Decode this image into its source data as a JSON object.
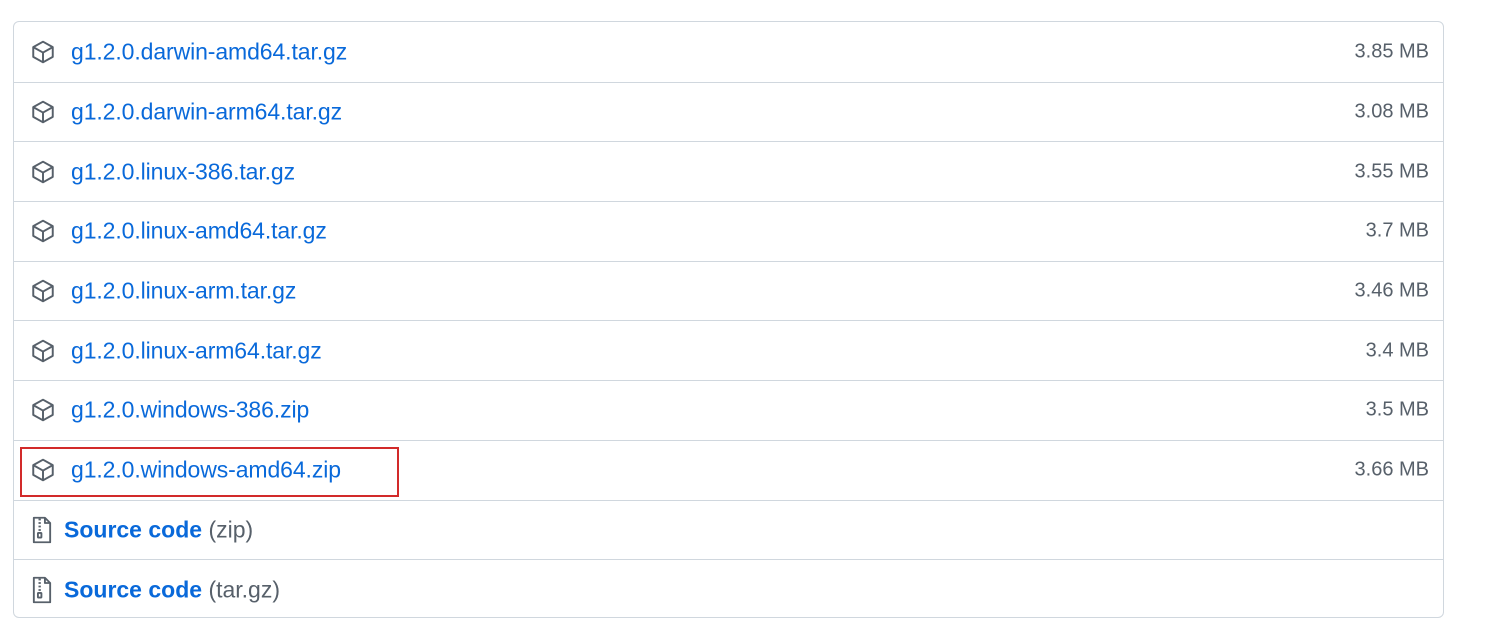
{
  "assets": [
    {
      "name": "g1.2.0.darwin-amd64.tar.gz",
      "size": "3.85 MB",
      "icon": "package-icon"
    },
    {
      "name": "g1.2.0.darwin-arm64.tar.gz",
      "size": "3.08 MB",
      "icon": "package-icon"
    },
    {
      "name": "g1.2.0.linux-386.tar.gz",
      "size": "3.55 MB",
      "icon": "package-icon"
    },
    {
      "name": "g1.2.0.linux-amd64.tar.gz",
      "size": "3.7 MB",
      "icon": "package-icon"
    },
    {
      "name": "g1.2.0.linux-arm.tar.gz",
      "size": "3.46 MB",
      "icon": "package-icon"
    },
    {
      "name": "g1.2.0.linux-arm64.tar.gz",
      "size": "3.4 MB",
      "icon": "package-icon"
    },
    {
      "name": "g1.2.0.windows-386.zip",
      "size": "3.5 MB",
      "icon": "package-icon"
    },
    {
      "name": "g1.2.0.windows-amd64.zip",
      "size": "3.66 MB",
      "icon": "package-icon",
      "highlighted": true
    }
  ],
  "source_code": [
    {
      "label": "Source code",
      "format": "(zip)",
      "icon": "file-zip-icon"
    },
    {
      "label": "Source code",
      "format": "(tar.gz)",
      "icon": "file-zip-icon"
    }
  ],
  "colors": {
    "link": "#0969da",
    "muted": "#57606a",
    "border": "#d0d7de",
    "highlight": "#d22a2a"
  }
}
